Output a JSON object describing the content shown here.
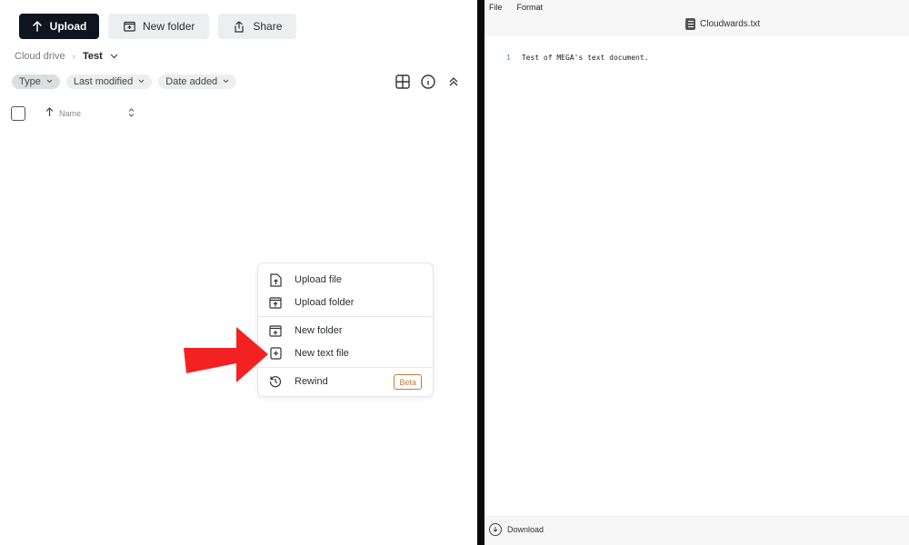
{
  "toolbar": {
    "upload_label": "Upload",
    "new_folder_label": "New folder",
    "share_label": "Share"
  },
  "breadcrumb": {
    "root": "Cloud drive",
    "separator": "›",
    "current": "Test"
  },
  "filters": [
    "Type",
    "Last modified",
    "Date added"
  ],
  "list_header": {
    "name_col": "Name"
  },
  "context_menu": {
    "upload_file": "Upload file",
    "upload_folder": "Upload folder",
    "new_folder": "New folder",
    "new_text_file": "New text file",
    "rewind": "Rewind",
    "beta_badge": "Beta"
  },
  "editor": {
    "menu_file": "File",
    "menu_format": "Format",
    "doc_title": "Cloudwards.txt",
    "line_number": "1",
    "line_text": "Test of MEGA's text document.",
    "download_label": "Download"
  },
  "colors": {
    "primary_button": "#0e1520",
    "arrow": "#f22222",
    "beta": "#c7793a"
  }
}
